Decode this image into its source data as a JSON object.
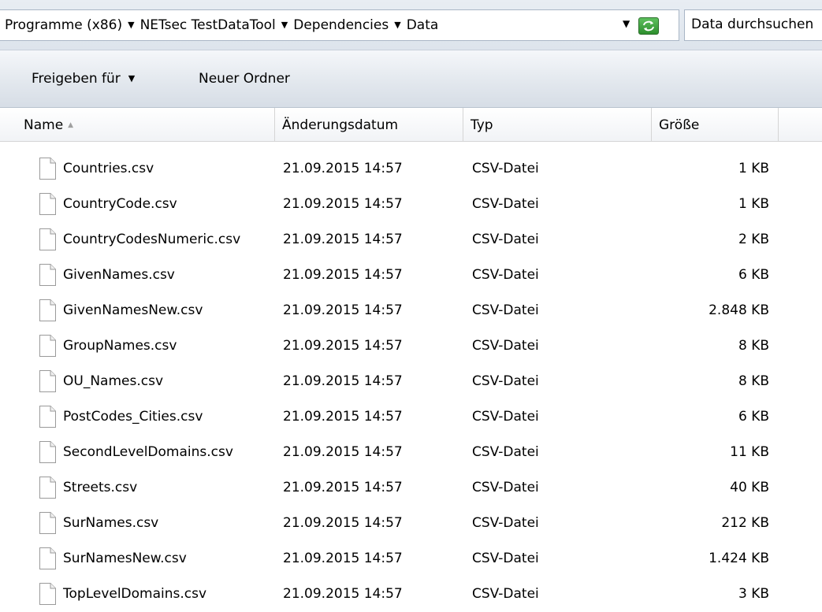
{
  "address": {
    "crumbs": [
      "Programme (x86)",
      "NETsec TestDataTool",
      "Dependencies",
      "Data"
    ],
    "dropdown_icon": "chevron-down-icon",
    "refresh_icon": "refresh-icon"
  },
  "search": {
    "placeholder": "Data durchsuchen"
  },
  "toolbar": {
    "share_label": "Freigeben für",
    "new_folder_label": "Neuer Ordner"
  },
  "columns": {
    "name": "Name",
    "date": "Änderungsdatum",
    "type": "Typ",
    "size": "Größe"
  },
  "files": [
    {
      "name": "Countries.csv",
      "date": "21.09.2015 14:57",
      "type": "CSV-Datei",
      "size": "1 KB"
    },
    {
      "name": "CountryCode.csv",
      "date": "21.09.2015 14:57",
      "type": "CSV-Datei",
      "size": "1 KB"
    },
    {
      "name": "CountryCodesNumeric.csv",
      "date": "21.09.2015 14:57",
      "type": "CSV-Datei",
      "size": "2 KB"
    },
    {
      "name": "GivenNames.csv",
      "date": "21.09.2015 14:57",
      "type": "CSV-Datei",
      "size": "6 KB"
    },
    {
      "name": "GivenNamesNew.csv",
      "date": "21.09.2015 14:57",
      "type": "CSV-Datei",
      "size": "2.848 KB"
    },
    {
      "name": "GroupNames.csv",
      "date": "21.09.2015 14:57",
      "type": "CSV-Datei",
      "size": "8 KB"
    },
    {
      "name": "OU_Names.csv",
      "date": "21.09.2015 14:57",
      "type": "CSV-Datei",
      "size": "8 KB"
    },
    {
      "name": "PostCodes_Cities.csv",
      "date": "21.09.2015 14:57",
      "type": "CSV-Datei",
      "size": "6 KB"
    },
    {
      "name": "SecondLevelDomains.csv",
      "date": "21.09.2015 14:57",
      "type": "CSV-Datei",
      "size": "11 KB"
    },
    {
      "name": "Streets.csv",
      "date": "21.09.2015 14:57",
      "type": "CSV-Datei",
      "size": "40 KB"
    },
    {
      "name": "SurNames.csv",
      "date": "21.09.2015 14:57",
      "type": "CSV-Datei",
      "size": "212 KB"
    },
    {
      "name": "SurNamesNew.csv",
      "date": "21.09.2015 14:57",
      "type": "CSV-Datei",
      "size": "1.424 KB"
    },
    {
      "name": "TopLevelDomains.csv",
      "date": "21.09.2015 14:57",
      "type": "CSV-Datei",
      "size": "3 KB"
    }
  ]
}
